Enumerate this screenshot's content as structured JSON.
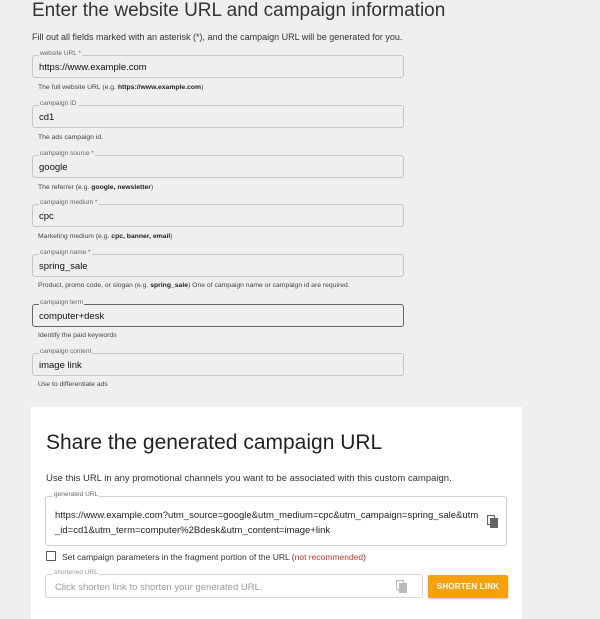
{
  "title": "Enter the website URL and campaign information",
  "intro": "Fill out all fields marked with an asterisk (*), and the campaign URL will be generated for you.",
  "fields": [
    {
      "label": "website URL *",
      "value": "https://www.example.com",
      "help_pre": "The full website URL (e.g. ",
      "help_bold": "https://www.example.com",
      "help_post": ")"
    },
    {
      "label": "campaign ID",
      "value": "cd1",
      "help_pre": "The ads campaign id.",
      "help_bold": "",
      "help_post": ""
    },
    {
      "label": "campaign source *",
      "value": "google",
      "help_pre": "The referrer (e.g. ",
      "help_bold": "google, newsletter",
      "help_post": ")"
    },
    {
      "label": "campaign medium *",
      "value": "cpc",
      "help_pre": "Marketing medium (e.g. ",
      "help_bold": "cpc, banner, email",
      "help_post": ")"
    },
    {
      "label": "campaign name *",
      "value": "spring_sale",
      "help_pre": "Product, promo code, or slogan (e.g. ",
      "help_bold": "spring_sale",
      "help_post": ") One of campaign name or campaign id are required."
    },
    {
      "label": "campaign term",
      "value": "computer+desk",
      "help_pre": "Identify the paid keywords",
      "help_bold": "",
      "help_post": ""
    },
    {
      "label": "campaign content",
      "value": "image link",
      "help_pre": "Use to differentiate ads",
      "help_bold": "",
      "help_post": ""
    }
  ],
  "share": {
    "title": "Share the generated campaign URL",
    "description": "Use this URL in any promotional channels you want to be associated with this custom campaign.",
    "generated_label": "generated URL",
    "generated_url": "https://www.example.com?utm_source=google&utm_medium=cpc&utm_campaign=spring_sale&utm_id=cd1&utm_term=computer%2Bdesk&utm_content=image+link",
    "checkbox_label": "Set campaign parameters in the fragment portion of the URL (",
    "checkbox_warning": "not recommended",
    "checkbox_close": ")",
    "checkbox_checked": false,
    "shortened_label": "shortened URL",
    "shortened_placeholder": "Click shorten link to shorten your generated URL.",
    "shorten_button": "SHORTEN LINK"
  },
  "colors": {
    "accent": "#f5a20e",
    "background": "#efefef",
    "warning": "#c0392b"
  },
  "icons": [
    "copy-icon",
    "copy-icon"
  ]
}
